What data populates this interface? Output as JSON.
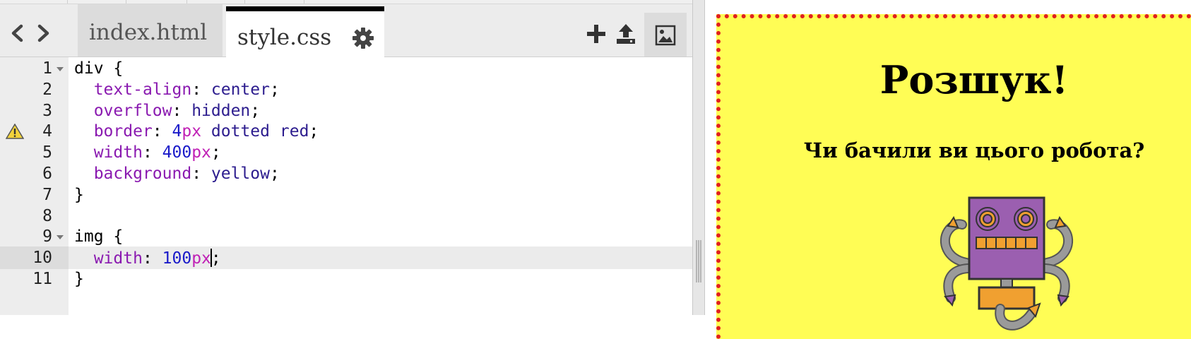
{
  "editor": {
    "tabs": [
      {
        "label": "index.html",
        "active": false
      },
      {
        "label": "style.css",
        "active": true
      }
    ],
    "lines": [
      {
        "number": "1",
        "tokens": [
          [
            "plain",
            "div {"
          ]
        ],
        "foldable": true
      },
      {
        "number": "2",
        "tokens": [
          [
            "plain",
            "  "
          ],
          [
            "prop",
            "text-align"
          ],
          [
            "plain",
            ": "
          ],
          [
            "val",
            "center"
          ],
          [
            "plain",
            ";"
          ]
        ]
      },
      {
        "number": "3",
        "tokens": [
          [
            "plain",
            "  "
          ],
          [
            "prop",
            "overflow"
          ],
          [
            "plain",
            ": "
          ],
          [
            "val",
            "hidden"
          ],
          [
            "plain",
            ";"
          ]
        ]
      },
      {
        "number": "4",
        "tokens": [
          [
            "plain",
            "  "
          ],
          [
            "prop",
            "border"
          ],
          [
            "plain",
            ": "
          ],
          [
            "num",
            "4"
          ],
          [
            "unit",
            "px"
          ],
          [
            "plain",
            " "
          ],
          [
            "val",
            "dotted"
          ],
          [
            "plain",
            " "
          ],
          [
            "val",
            "red"
          ],
          [
            "plain",
            ";"
          ]
        ],
        "warning": true
      },
      {
        "number": "5",
        "tokens": [
          [
            "plain",
            "  "
          ],
          [
            "prop",
            "width"
          ],
          [
            "plain",
            ": "
          ],
          [
            "num",
            "400"
          ],
          [
            "unit",
            "px"
          ],
          [
            "plain",
            ";"
          ]
        ]
      },
      {
        "number": "6",
        "tokens": [
          [
            "plain",
            "  "
          ],
          [
            "prop",
            "background"
          ],
          [
            "plain",
            ": "
          ],
          [
            "val",
            "yellow"
          ],
          [
            "plain",
            ";"
          ]
        ]
      },
      {
        "number": "7",
        "tokens": [
          [
            "plain",
            "}"
          ]
        ]
      },
      {
        "number": "8",
        "tokens": []
      },
      {
        "number": "9",
        "tokens": [
          [
            "plain",
            "img {"
          ]
        ],
        "foldable": true
      },
      {
        "number": "10",
        "tokens": [
          [
            "plain",
            "  "
          ],
          [
            "prop",
            "width"
          ],
          [
            "plain",
            ": "
          ],
          [
            "num",
            "100"
          ],
          [
            "unit",
            "px"
          ],
          [
            "caret",
            ""
          ],
          [
            "plain",
            ";"
          ]
        ],
        "active": true
      },
      {
        "number": "11",
        "tokens": [
          [
            "plain",
            "}"
          ]
        ]
      }
    ],
    "icons": {
      "back": "chevron-left-icon",
      "forward": "chevron-right-icon",
      "settings": "gear-icon",
      "add": "plus-icon",
      "upload": "upload-icon",
      "image": "image-icon",
      "warning": "warning-icon"
    }
  },
  "preview": {
    "heading": "Розшук!",
    "subheading": "Чи бачили ви цього робота?",
    "image_alt": "robot-image",
    "colors": {
      "background": "#fffd55",
      "border": "#e02020"
    }
  }
}
